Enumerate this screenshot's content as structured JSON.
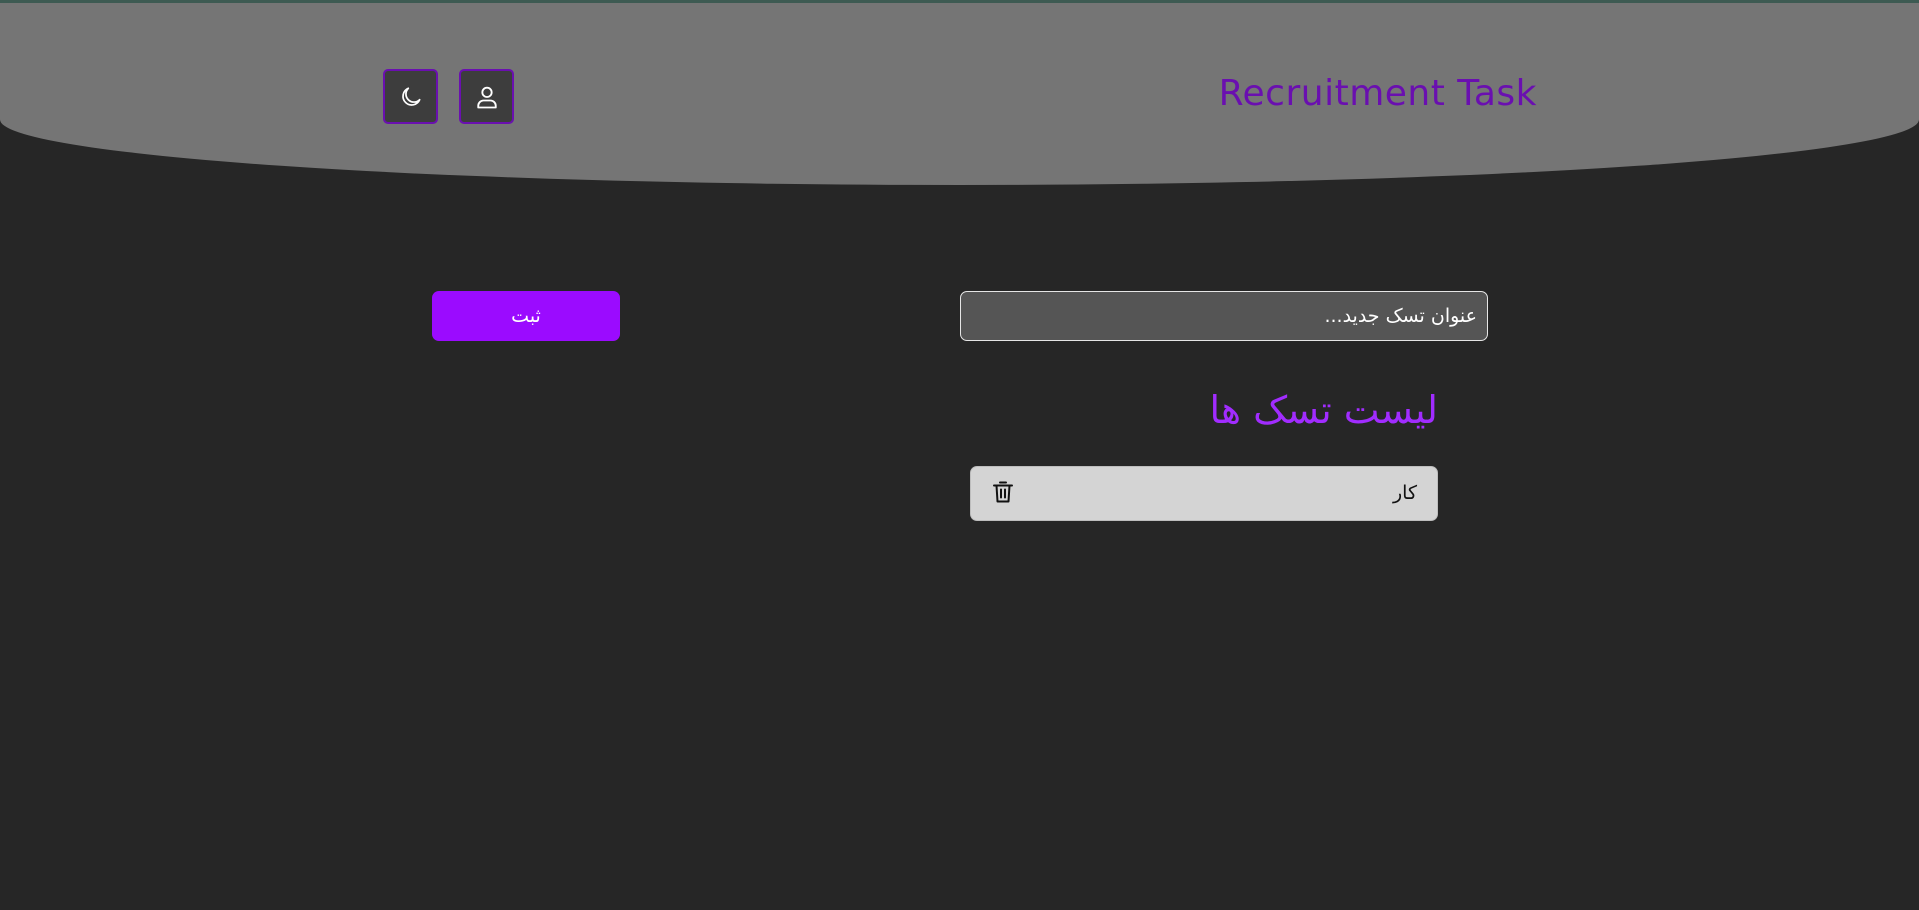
{
  "header": {
    "brand": "Recruitment Task",
    "theme_toggle_icon": "moon-icon",
    "profile_icon": "user-icon"
  },
  "form": {
    "input_placeholder": "عنوان تسک جدید...",
    "submit_label": "ثبت"
  },
  "tasks": {
    "title": "لیست تسک ها",
    "items": [
      {
        "text": "کار",
        "delete_icon": "trash-icon"
      }
    ]
  },
  "colors": {
    "background": "#262626",
    "header": "#757575",
    "accent": "#9b0bff",
    "brand": "#6a0fb0",
    "list_title": "#a12cff",
    "task_item": "#d4d4d4"
  }
}
